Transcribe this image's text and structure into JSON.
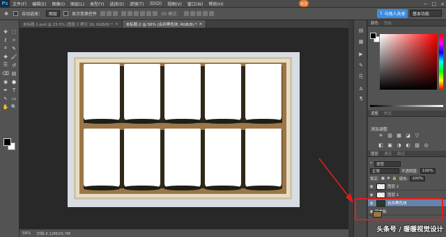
{
  "menubar": {
    "logo": "Ps",
    "items": [
      "文件(F)",
      "编辑(E)",
      "图像(I)",
      "图层(L)",
      "类型(Y)",
      "选择(S)",
      "滤镜(T)",
      "3D(D)",
      "视图(V)",
      "窗口(W)",
      "帮助(H)"
    ],
    "user_badge": "关注",
    "window_controls": [
      "−",
      "□",
      "×"
    ]
  },
  "options": {
    "auto_select_label": "自动选择：",
    "auto_select_value": "图层",
    "show_transform_label": "显示变换控件",
    "mode_3d_label": "3D 模式：",
    "share_label": "与他人共享",
    "workspace_value": "基本功能"
  },
  "tabs": [
    {
      "label": "未标题-1.psd @ 23.5% (图层 2 拷贝 16, RGB/8) *",
      "active": false
    },
    {
      "label": "未标题-2 @ 56% (合并黑色块, RGB/8) *",
      "active": true
    }
  ],
  "tools": {
    "icons": [
      "move-icon",
      "marquee-icon",
      "lasso-icon",
      "magic-wand-icon",
      "crop-icon",
      "eyedropper-icon",
      "healing-brush-icon",
      "brush-icon",
      "clone-stamp-icon",
      "history-brush-icon",
      "eraser-icon",
      "gradient-icon",
      "blur-icon",
      "dodge-icon",
      "pen-icon",
      "type-icon",
      "path-select-icon",
      "shape-icon",
      "hand-icon",
      "zoom-icon"
    ],
    "glyphs": [
      "✥",
      "⬚",
      "ℓ",
      "✧",
      "⌗",
      "✎",
      "✚",
      "🖌",
      "⎘",
      "↺",
      "⌫",
      "▤",
      "◉",
      "●",
      "✒",
      "T",
      "↖",
      "▭",
      "✋",
      "🔍"
    ],
    "fg_color": "#000000",
    "bg_color": "#ffffff"
  },
  "status": {
    "zoom": "56%",
    "doc_info": "文档:3.12M/25.7M"
  },
  "panels": {
    "color_tabs": [
      "颜色",
      "色板"
    ],
    "adjust_tabs": [
      "调整",
      "样式"
    ],
    "adjust_title": "添加调整",
    "adjust_glyphs": [
      "☀",
      "▥",
      "▦",
      "◪",
      "▽",
      "◧",
      "▣",
      "◑",
      "◐",
      "▧",
      "◎",
      "▦",
      "◩",
      "◫",
      "◭",
      "▨",
      "◮"
    ],
    "layers_tabs": [
      "图层",
      "通道",
      "路径"
    ],
    "kind_label": "类型",
    "blend_mode": "正常",
    "opacity_label": "不透明度:",
    "opacity_value": "100%",
    "lock_label": "锁定:",
    "fill_label": "填充:",
    "fill_value": "100%",
    "layers": [
      {
        "name": "图层 2",
        "thumb": "blank",
        "selected": false
      },
      {
        "name": "图层 1",
        "thumb": "blank",
        "selected": false
      },
      {
        "name": "合并黑色块",
        "thumb": "merged",
        "selected": true
      },
      {
        "name": "留言板",
        "thumb": "cork",
        "selected": false
      }
    ]
  },
  "watermark": "头条号 / 暖暖视觉设计",
  "accent_red": "#e01e1e"
}
